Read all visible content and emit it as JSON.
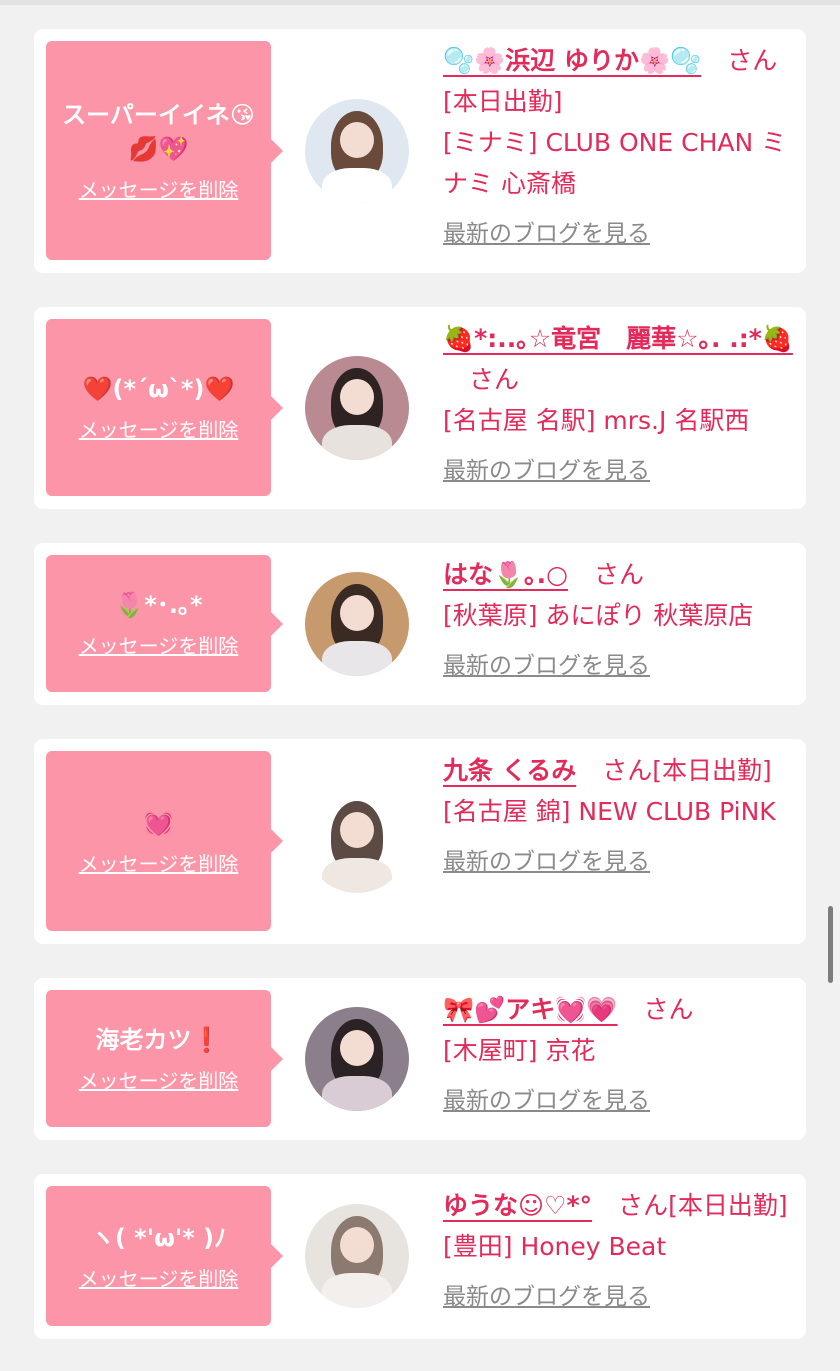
{
  "common": {
    "delete_label": "メッセージを削除",
    "blog_label": "最新のブログを見る",
    "honorific": "さん"
  },
  "cards": [
    {
      "message_line1": "スーパーイイネ😘",
      "message_line2": "💋💖",
      "name": "🫧🌸浜辺 ゆりか🌸🫧",
      "suffix": "[本日出勤]",
      "shop": "[ミナミ] CLUB ONE CHAN ミナミ 心斎橋",
      "avatar_colors": {
        "bg": "#dfe8f0",
        "hair": "#6a4a3a",
        "body": "#ffffff"
      }
    },
    {
      "message_line1": "❤️(*´ω`*)❤️",
      "message_line2": "",
      "name": "🍓*:..｡☆竜宮　麗華☆｡. .:*🍓",
      "suffix": "",
      "shop": "[名古屋 名駅] mrs.J 名駅西",
      "avatar_colors": {
        "bg": "#b98a92",
        "hair": "#2e2222",
        "body": "#e8e2df"
      }
    },
    {
      "message_line1": "🌷*･.｡*",
      "message_line2": "",
      "name": "はな🌷｡.○",
      "suffix": "",
      "shop": "[秋葉原] あにぽり 秋葉原店",
      "avatar_colors": {
        "bg": "#c79a6e",
        "hair": "#3a2a24",
        "body": "#e9e6ea"
      }
    },
    {
      "message_line1": "💓",
      "message_line2": "",
      "name": "九条 くるみ",
      "suffix": "[本日出勤]",
      "shop": "[名古屋 錦] NEW CLUB PiNK",
      "avatar_colors": {
        "bg": "#ffffff",
        "hair": "#5c4a44",
        "body": "#efe8e2"
      }
    },
    {
      "message_line1": "海老カツ❗️",
      "message_line2": "",
      "name": "🎀💕アキ💓💗",
      "suffix": "",
      "shop": "[木屋町] 京花",
      "avatar_colors": {
        "bg": "#8b7f8c",
        "hair": "#2b2226",
        "body": "#d9ccd5"
      }
    },
    {
      "message_line1": "ヽ( *'ω'* )ﾉ",
      "message_line2": "",
      "name": "ゆうな☺︎♡*°",
      "suffix": "[本日出勤]",
      "shop": "[豊田] Honey Beat",
      "avatar_colors": {
        "bg": "#e7e4e0",
        "hair": "#8c7a70",
        "body": "#f3efec"
      }
    }
  ]
}
